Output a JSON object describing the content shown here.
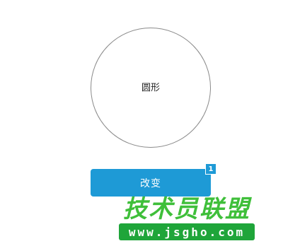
{
  "shape": {
    "label": "圆形"
  },
  "button": {
    "label": "改变",
    "badge": "1"
  },
  "watermark": {
    "title": "技术员联盟",
    "url": "www.jsgho.com"
  },
  "colors": {
    "button": "#1e9ad6",
    "circle_border": "#8a8a8a",
    "watermark_green": "#3fbf3a"
  }
}
